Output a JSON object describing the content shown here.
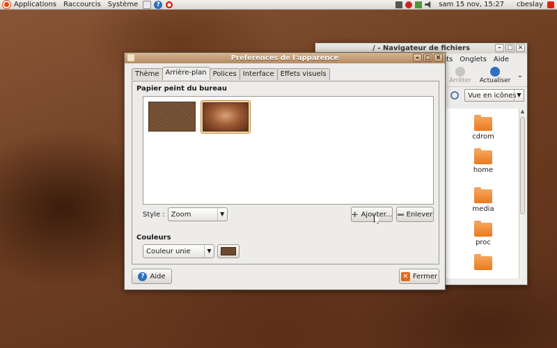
{
  "top_panel": {
    "menus": [
      "Applications",
      "Raccourcis",
      "Système"
    ],
    "clock": "sam 15 nov, 15:27",
    "user": "cbeslay"
  },
  "file_browser": {
    "title": "/ - Navigateur de fichiers",
    "menu": [
      "ets",
      "Onglets",
      "Aide"
    ],
    "toolbar": {
      "stop": "Arrêter",
      "reload": "Actualiser"
    },
    "view_mode": "Vue en icônes",
    "folders": [
      "cdrom",
      "home",
      "media",
      "proc"
    ]
  },
  "dialog": {
    "title": "Préférences de l'apparence",
    "tabs": [
      "Thème",
      "Arrière-plan",
      "Polices",
      "Interface",
      "Effets visuels"
    ],
    "active_tab": "Arrière-plan",
    "wallpaper_heading": "Papier peint du bureau",
    "style_label": "Style :",
    "style_value": "Zoom",
    "add_button": "Ajouter...",
    "remove_button": "Enlever",
    "colors_heading": "Couleurs",
    "color_mode": "Couleur unie",
    "color_value": "#6b4a30",
    "help_button": "Aide",
    "close_button": "Fermer"
  }
}
